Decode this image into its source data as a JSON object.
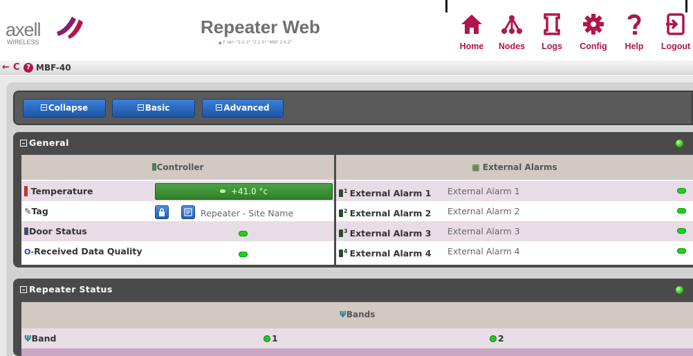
{
  "brand": {
    "logo_word": "axell",
    "logo_sub": "WIRELESS",
    "app_title": "Repeater Web",
    "version_text": "F Ver: \"2.0.3\" \"2.1.0\" \"MBF 2.0.2\""
  },
  "nav": {
    "items": [
      {
        "label": "Home",
        "icon": "home-icon"
      },
      {
        "label": "Nodes",
        "icon": "nodes-icon"
      },
      {
        "label": "Logs",
        "icon": "logs-icon"
      },
      {
        "label": "Config",
        "icon": "config-icon"
      },
      {
        "label": "Help",
        "icon": "help-icon"
      },
      {
        "label": "Logout",
        "icon": "logout-icon"
      }
    ]
  },
  "breadcrumb": {
    "back_glyph": "←",
    "refresh_glyph": "C",
    "help_glyph": "?",
    "text": "MBF-40"
  },
  "toolbar": {
    "collapse_label": "Collapse",
    "basic_label": "Basic",
    "advanced_label": "Advanced"
  },
  "general": {
    "title": "General",
    "status_color": "#2fc31a",
    "controller_header": "Controller",
    "alarms_header": "External Alarms",
    "rows": [
      {
        "label": "Temperature",
        "icon": "thermometer-icon"
      },
      {
        "label": "Tag",
        "icon": "tag-icon"
      },
      {
        "label": "Door Status",
        "icon": "door-icon"
      },
      {
        "label": "Received Data Quality",
        "icon": "key-icon"
      }
    ],
    "temperature_value": "+41.0 °c",
    "tag_value": "Repeater - Site Name",
    "alarms": [
      {
        "num": "1",
        "label": "External Alarm 1",
        "value": "External Alarm 1"
      },
      {
        "num": "2",
        "label": "External Alarm 2",
        "value": "External Alarm 2"
      },
      {
        "num": "3",
        "label": "External Alarm 3",
        "value": "External Alarm 3"
      },
      {
        "num": "4",
        "label": "External Alarm 4",
        "value": "External Alarm 4"
      }
    ]
  },
  "repeater_status": {
    "title": "Repeater Status",
    "bands_header": "Bands",
    "band_label": "Band",
    "bands": [
      "1",
      "2"
    ]
  },
  "colors": {
    "accent": "#b1154b",
    "button_blue": "#2563b8",
    "status_green": "#2fc31a"
  }
}
